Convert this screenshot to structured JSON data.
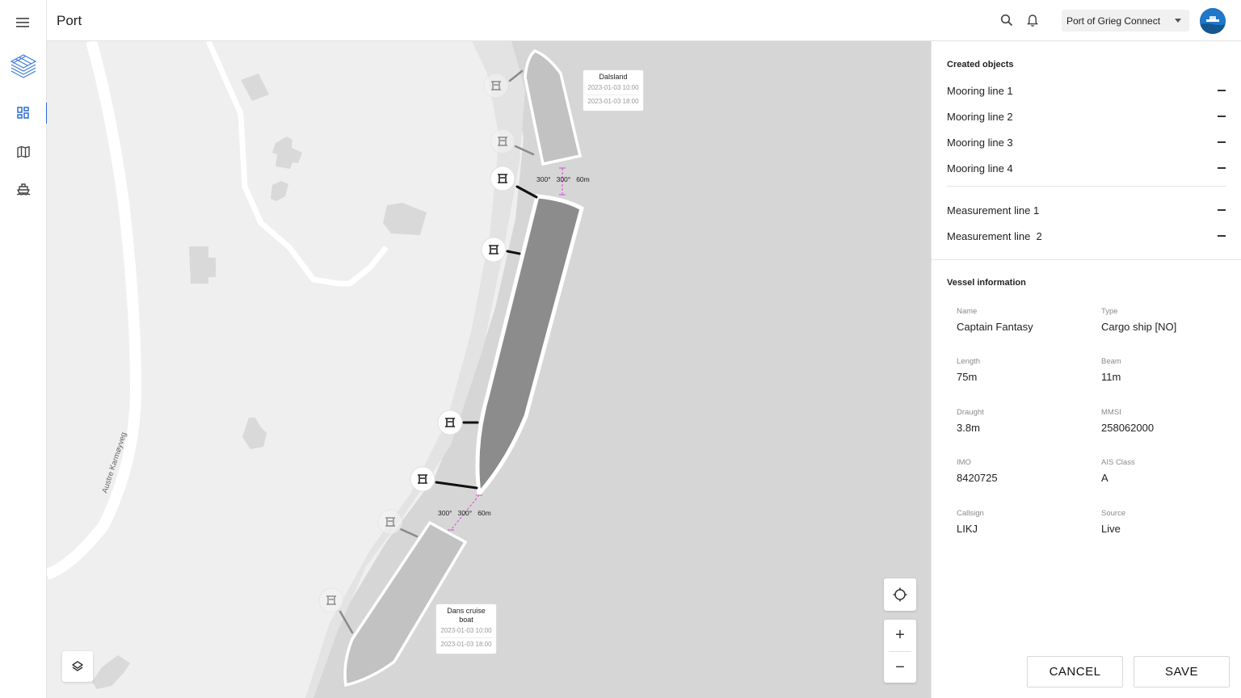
{
  "header": {
    "title": "Port",
    "port_select": "Port of Grieg Connect"
  },
  "rail": {
    "items": [
      "menu-icon",
      "logo",
      "dashboard-icon",
      "map-icon",
      "vessel-icon"
    ]
  },
  "map": {
    "street_label": "Austre Karmøyveg",
    "vessels": [
      {
        "name": "Dalsland",
        "eta": "2023-01-03 10:00",
        "etd": "2023-01-03 18:00"
      },
      {
        "name": "Dans cruise boat",
        "eta": "2023-01-03 10:00",
        "etd": "2023-01-03 18:00"
      }
    ],
    "measurements": [
      {
        "a1": "300°",
        "a2": "300°",
        "dist": "60m"
      },
      {
        "a1": "300°",
        "a2": "300°",
        "dist": "60m"
      }
    ],
    "zoom_in": "+",
    "zoom_out": "−"
  },
  "panel": {
    "created_title": "Created objects",
    "mooring_lines": [
      "Mooring line 1",
      "Mooring line 2",
      "Mooring line 3",
      "Mooring line 4"
    ],
    "measurement_lines": [
      "Measurement line 1",
      "Measurement line  2"
    ],
    "vessel_title": "Vessel information",
    "vessel": {
      "name_label": "Name",
      "name": "Captain Fantasy",
      "type_label": "Type",
      "type": "Cargo ship [NO]",
      "length_label": "Length",
      "length": "75m",
      "beam_label": "Beam",
      "beam": "11m",
      "draught_label": "Draught",
      "draught": "3.8m",
      "mmsi_label": "MMSI",
      "mmsi": "258062000",
      "imo_label": "IMO",
      "imo": "8420725",
      "ais_label": "AIS Class",
      "ais": "A",
      "callsign_label": "Callsign",
      "callsign": "LIKJ",
      "source_label": "Source",
      "source": "Live"
    },
    "cancel_label": "CANCEL",
    "save_label": "SAVE"
  },
  "colors": {
    "accent": "#2a6bd6",
    "map_land": "#efefef",
    "map_water": "#d6d6d6",
    "selected_vessel": "#8c8c8c",
    "other_vessel": "#c2c2c2",
    "measurement_line": "#d24fd2"
  }
}
